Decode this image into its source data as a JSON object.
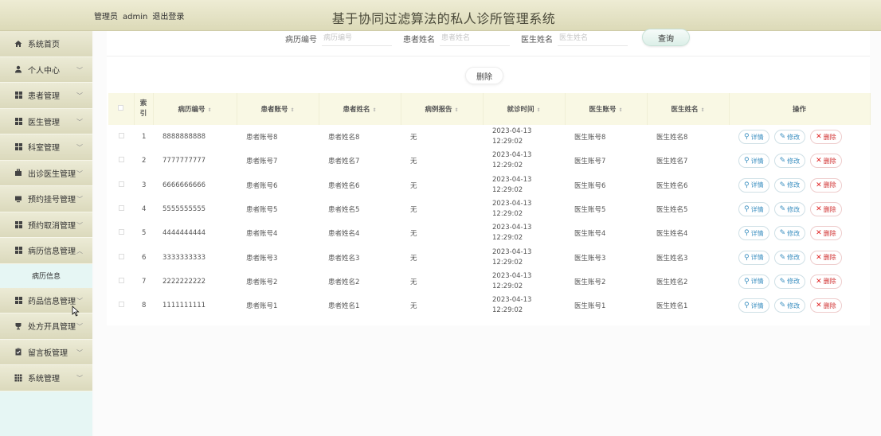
{
  "header": {
    "role": "管理员",
    "username": "admin",
    "logout": "退出登录",
    "title": "基于协同过滤算法的私人诊所管理系统"
  },
  "sidebar": {
    "items": [
      {
        "label": "系统首页",
        "icon": "home-icon",
        "chevron": false
      },
      {
        "label": "个人中心",
        "icon": "user-icon",
        "chevron": true
      },
      {
        "label": "患者管理",
        "icon": "grid-icon",
        "chevron": true
      },
      {
        "label": "医生管理",
        "icon": "grid-icon",
        "chevron": true
      },
      {
        "label": "科室管理",
        "icon": "grid-icon",
        "chevron": true
      },
      {
        "label": "出诊医生管理",
        "icon": "briefcase-icon",
        "chevron": true
      },
      {
        "label": "预约挂号管理",
        "icon": "monitor-icon",
        "chevron": true
      },
      {
        "label": "预约取消管理",
        "icon": "grid-icon",
        "chevron": true
      },
      {
        "label": "病历信息管理",
        "icon": "grid-icon",
        "chevron": true,
        "expanded": true
      },
      {
        "label": "药品信息管理",
        "icon": "grid-icon",
        "chevron": true
      },
      {
        "label": "处方开具管理",
        "icon": "cup-icon",
        "chevron": true
      },
      {
        "label": "留言板管理",
        "icon": "clipboard-icon",
        "chevron": true
      },
      {
        "label": "系统管理",
        "icon": "apps-icon",
        "chevron": true
      }
    ],
    "submenu": {
      "label": "病历信息"
    }
  },
  "search": {
    "fields": [
      {
        "label": "病历编号",
        "placeholder": "病历编号"
      },
      {
        "label": "患者姓名",
        "placeholder": "患者姓名"
      },
      {
        "label": "医生姓名",
        "placeholder": "医生姓名"
      }
    ],
    "query_label": "查询"
  },
  "batch_delete_label": "删除",
  "table": {
    "columns": [
      "索引",
      "病历编号",
      "患者账号",
      "患者姓名",
      "病例报告",
      "就诊时间",
      "医生账号",
      "医生姓名",
      "操作"
    ],
    "actions": {
      "detail": "详情",
      "edit": "修改",
      "delete": "删除"
    },
    "rows": [
      {
        "idx": "1",
        "record_no": "8888888888",
        "patient_account": "患者账号8",
        "patient_name": "患者姓名8",
        "report": "无",
        "visit_time": "2023-04-13 12:29:02",
        "doctor_account": "医生账号8",
        "doctor_name": "医生姓名8"
      },
      {
        "idx": "2",
        "record_no": "7777777777",
        "patient_account": "患者账号7",
        "patient_name": "患者姓名7",
        "report": "无",
        "visit_time": "2023-04-13 12:29:02",
        "doctor_account": "医生账号7",
        "doctor_name": "医生姓名7"
      },
      {
        "idx": "3",
        "record_no": "6666666666",
        "patient_account": "患者账号6",
        "patient_name": "患者姓名6",
        "report": "无",
        "visit_time": "2023-04-13 12:29:02",
        "doctor_account": "医生账号6",
        "doctor_name": "医生姓名6"
      },
      {
        "idx": "4",
        "record_no": "5555555555",
        "patient_account": "患者账号5",
        "patient_name": "患者姓名5",
        "report": "无",
        "visit_time": "2023-04-13 12:29:02",
        "doctor_account": "医生账号5",
        "doctor_name": "医生姓名5"
      },
      {
        "idx": "5",
        "record_no": "4444444444",
        "patient_account": "患者账号4",
        "patient_name": "患者姓名4",
        "report": "无",
        "visit_time": "2023-04-13 12:29:02",
        "doctor_account": "医生账号4",
        "doctor_name": "医生姓名4"
      },
      {
        "idx": "6",
        "record_no": "3333333333",
        "patient_account": "患者账号3",
        "patient_name": "患者姓名3",
        "report": "无",
        "visit_time": "2023-04-13 12:29:02",
        "doctor_account": "医生账号3",
        "doctor_name": "医生姓名3"
      },
      {
        "idx": "7",
        "record_no": "2222222222",
        "patient_account": "患者账号2",
        "patient_name": "患者姓名2",
        "report": "无",
        "visit_time": "2023-04-13 12:29:02",
        "doctor_account": "医生账号2",
        "doctor_name": "医生姓名2"
      },
      {
        "idx": "8",
        "record_no": "1111111111",
        "patient_account": "患者账号1",
        "patient_name": "患者姓名1",
        "report": "无",
        "visit_time": "2023-04-13 12:29:02",
        "doctor_account": "医生账号1",
        "doctor_name": "医生姓名1"
      }
    ]
  }
}
